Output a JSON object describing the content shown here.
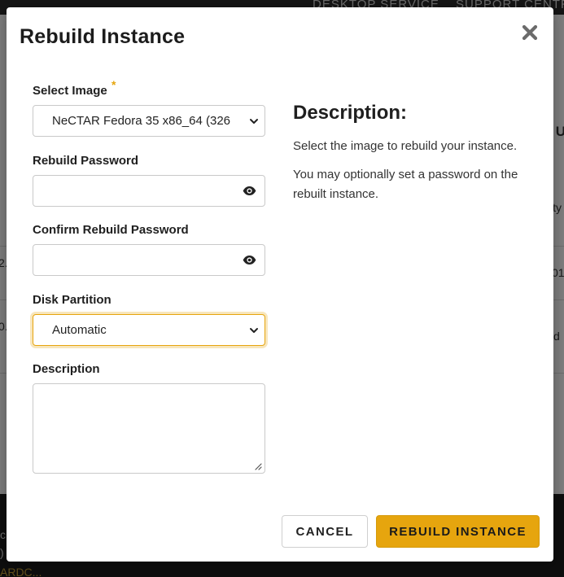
{
  "background": {
    "nav": [
      "DESKTOP SERVICE",
      "SUPPORT CENTRE"
    ],
    "column_header": "U",
    "row_fragments": {
      "left": [
        "2.",
        "0."
      ],
      "right": [
        "ity",
        "01",
        "d"
      ]
    },
    "footer_fragments": [
      "c",
      ")"
    ],
    "footer_link": "ARDC..."
  },
  "modal": {
    "title": "Rebuild Instance",
    "close_icon": "close-icon"
  },
  "form": {
    "select_image": {
      "label": "Select Image",
      "required_marker": "*",
      "value": "NeCTAR Fedora 35 x86_64 (326"
    },
    "rebuild_password": {
      "label": "Rebuild Password",
      "value": "",
      "icon": "eye-icon"
    },
    "confirm_password": {
      "label": "Confirm Rebuild Password",
      "value": "",
      "icon": "eye-icon"
    },
    "disk_partition": {
      "label": "Disk Partition",
      "value": "Automatic"
    },
    "description": {
      "label": "Description",
      "value": ""
    }
  },
  "help": {
    "heading": "Description:",
    "paragraphs": [
      "Select the image to rebuild your instance.",
      "You may optionally set a password on the rebuilt instance."
    ]
  },
  "actions": {
    "cancel_label": "CANCEL",
    "submit_label": "REBUILD INSTANCE"
  },
  "colors": {
    "accent": "#e6a50e",
    "backdrop": "rgba(0,0,0,0.5)"
  }
}
